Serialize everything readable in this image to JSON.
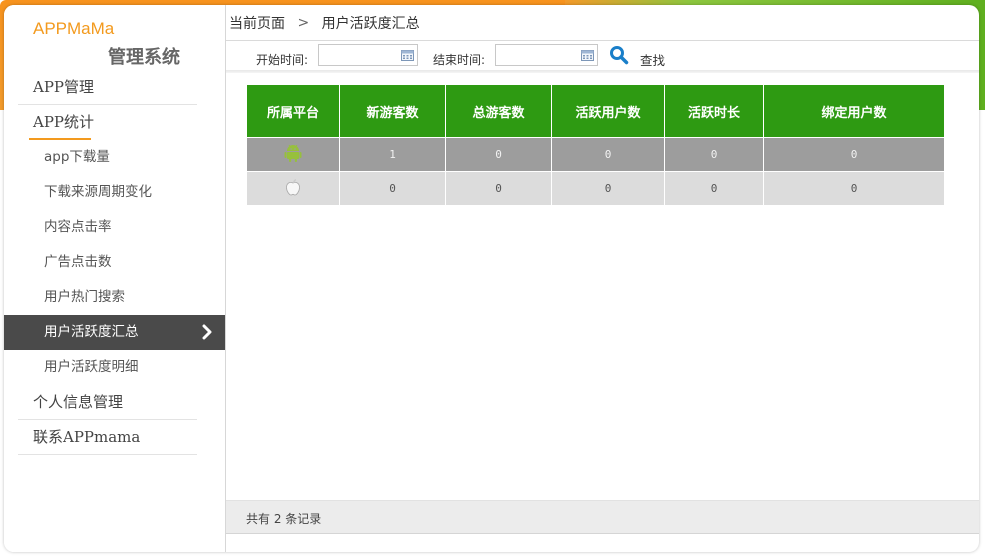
{
  "brand": {
    "name_en": "APPMaMa",
    "name_cn": "管理系统"
  },
  "sidebar": {
    "items": [
      {
        "label": "APP管理",
        "level": "top"
      },
      {
        "label": "APP统计",
        "level": "top"
      },
      {
        "label": "app下载量",
        "level": "sub"
      },
      {
        "label": "下载来源周期变化",
        "level": "sub"
      },
      {
        "label": "内容点击率",
        "level": "sub"
      },
      {
        "label": "广告点击数",
        "level": "sub"
      },
      {
        "label": "用户热门搜索",
        "level": "sub"
      },
      {
        "label": "用户活跃度汇总",
        "level": "sub",
        "active": true
      },
      {
        "label": "用户活跃度明细",
        "level": "sub"
      },
      {
        "label": "个人信息管理",
        "level": "top"
      },
      {
        "label": "联系APPmama",
        "level": "top"
      }
    ]
  },
  "breadcrumb": {
    "root": "当前页面",
    "separator": ">",
    "current": "用户活跃度汇总"
  },
  "filter": {
    "start_label": "开始时间:",
    "start_value": "",
    "end_label": "结束时间:",
    "end_value": "",
    "search_label": "查找"
  },
  "table": {
    "headers": [
      "所属平台",
      "新游客数",
      "总游客数",
      "活跃用户数",
      "活跃时长",
      "绑定用户数"
    ],
    "rows": [
      {
        "platform_icon": "android-icon",
        "values": [
          "1",
          "0",
          "0",
          "0",
          "0"
        ]
      },
      {
        "platform_icon": "apple-icon",
        "values": [
          "0",
          "0",
          "0",
          "0",
          "0"
        ]
      }
    ]
  },
  "footer": {
    "record_text": "共有 2 条记录"
  },
  "colors": {
    "accent_orange": "#f39a1e",
    "header_green": "#2e9a12",
    "active_item": "#4a4a4a"
  }
}
